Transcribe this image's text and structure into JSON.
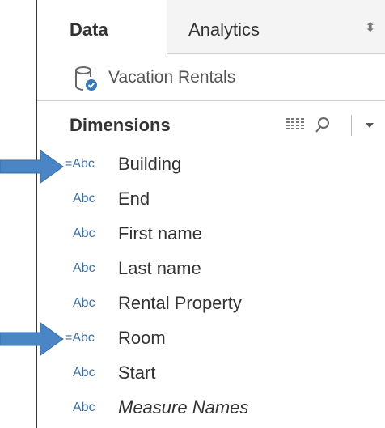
{
  "tabs": {
    "data_label": "Data",
    "analytics_label": "Analytics",
    "analytics_caret": "⬍"
  },
  "datasource": {
    "name": "Vacation Rentals",
    "icon": "datasource-icon"
  },
  "dimensions": {
    "header": "Dimensions",
    "menu_caret": "▾",
    "type_label": "Abc",
    "calc_type_label": "=Abc",
    "fields": [
      {
        "name": "Building"
      },
      {
        "name": "End"
      },
      {
        "name": "First name"
      },
      {
        "name": "Last name"
      },
      {
        "name": "Rental Property"
      },
      {
        "name": "Room"
      },
      {
        "name": "Start"
      },
      {
        "name": "Measure Names"
      }
    ]
  },
  "colors": {
    "accent_blue": "#4a86c6",
    "type_blue": "#3b6fa0"
  }
}
